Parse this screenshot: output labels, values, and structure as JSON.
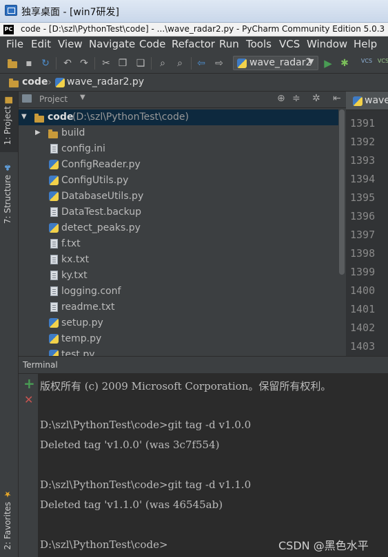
{
  "outer_window": {
    "title": "独享桌面 - [win7研发]"
  },
  "app": {
    "logo": "PC",
    "title": "code - [D:\\szl\\PythonTest\\code] - ...\\wave_radar2.py - PyCharm Community Edition 5.0.3"
  },
  "menu": [
    "File",
    "Edit",
    "View",
    "Navigate",
    "Code",
    "Refactor",
    "Run",
    "Tools",
    "VCS",
    "Window",
    "Help"
  ],
  "toolbar": {
    "run_config": "wave_radar2",
    "icons": [
      "open-folder-icon",
      "save-icon",
      "sync-icon",
      "undo-icon",
      "redo-icon",
      "cut-icon",
      "copy-icon",
      "paste-icon",
      "find-icon",
      "replace-icon",
      "back-icon",
      "forward-icon",
      "run-icon",
      "debug-icon",
      "vcs-update-icon",
      "vcs-commit-icon"
    ],
    "vcs_label": "VCS"
  },
  "breadcrumb": [
    "code",
    "wave_radar2.py"
  ],
  "left_stripe": {
    "project_tab": "1: Project",
    "structure_tab": "7: Structure",
    "favorites_tab": "2: Favorites"
  },
  "project_panel": {
    "header": "Project",
    "root": {
      "name": "code",
      "path": "(D:\\szl\\PythonTest\\code)"
    },
    "items": [
      {
        "name": "build",
        "type": "folder"
      },
      {
        "name": "config.ini",
        "type": "file"
      },
      {
        "name": "ConfigReader.py",
        "type": "python"
      },
      {
        "name": "ConfigUtils.py",
        "type": "python"
      },
      {
        "name": "DatabaseUtils.py",
        "type": "python"
      },
      {
        "name": "DataTest.backup",
        "type": "file"
      },
      {
        "name": "detect_peaks.py",
        "type": "python"
      },
      {
        "name": "f.txt",
        "type": "file"
      },
      {
        "name": "kx.txt",
        "type": "file"
      },
      {
        "name": "ky.txt",
        "type": "file"
      },
      {
        "name": "logging.conf",
        "type": "file"
      },
      {
        "name": "readme.txt",
        "type": "file"
      },
      {
        "name": "setup.py",
        "type": "python"
      },
      {
        "name": "temp.py",
        "type": "python"
      },
      {
        "name": "test.py",
        "type": "python"
      }
    ]
  },
  "editor": {
    "tab_label": "wave",
    "line_numbers": [
      "1391",
      "1392",
      "1393",
      "1394",
      "1395",
      "1396",
      "1397",
      "1398",
      "1399",
      "1400",
      "1401",
      "1402",
      "1403"
    ]
  },
  "terminal": {
    "title": "Terminal",
    "new_session": "+",
    "close_session": "✕",
    "lines": [
      "版权所有 (c) 2009 Microsoft Corporation。保留所有权利。",
      "",
      "D:\\szl\\PythonTest\\code>git tag -d v1.0.0",
      "Deleted tag 'v1.0.0' (was 3c7f554)",
      "",
      "D:\\szl\\PythonTest\\code>git tag -d v1.1.0",
      "Deleted tag 'v1.1.0' (was 46545ab)",
      "",
      "D:\\szl\\PythonTest\\code>"
    ]
  },
  "watermark": "CSDN @黑色水平",
  "colors": {
    "background": "#3c3f41",
    "editor": "#2b2b2b",
    "selection": "#0d293e",
    "run_green": "#499c54",
    "close_red": "#c75450"
  }
}
